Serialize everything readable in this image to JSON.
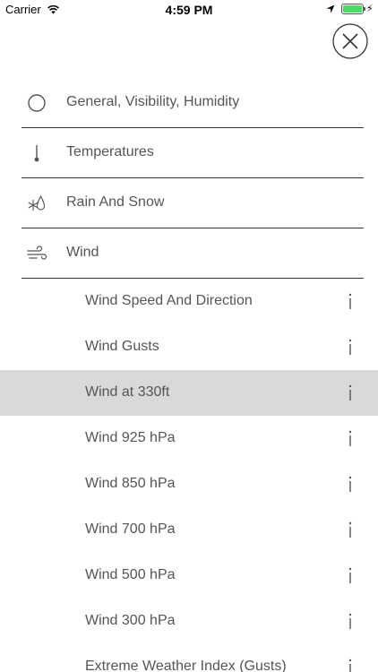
{
  "status": {
    "carrier": "Carrier",
    "time": "4:59 PM"
  },
  "categories": [
    {
      "label": "General, Visibility, Humidity",
      "icon": "circle-icon"
    },
    {
      "label": "Temperatures",
      "icon": "thermometer-icon"
    },
    {
      "label": "Rain And Snow",
      "icon": "rain-snow-icon"
    },
    {
      "label": "Wind",
      "icon": "wind-icon"
    }
  ],
  "wind_items": [
    {
      "label": "Wind Speed And Direction",
      "selected": false
    },
    {
      "label": "Wind Gusts",
      "selected": false
    },
    {
      "label": "Wind at 330ft",
      "selected": true
    },
    {
      "label": "Wind 925 hPa",
      "selected": false
    },
    {
      "label": "Wind 850 hPa",
      "selected": false
    },
    {
      "label": "Wind 700 hPa",
      "selected": false
    },
    {
      "label": "Wind 500 hPa",
      "selected": false
    },
    {
      "label": "Wind 300 hPa",
      "selected": false
    },
    {
      "label": "Extreme Weather Index (Gusts)",
      "selected": false
    }
  ],
  "colors": {
    "selected_row": "#d9d9d9",
    "text": "#555555",
    "divider": "#333333",
    "battery": "#4cd964"
  }
}
